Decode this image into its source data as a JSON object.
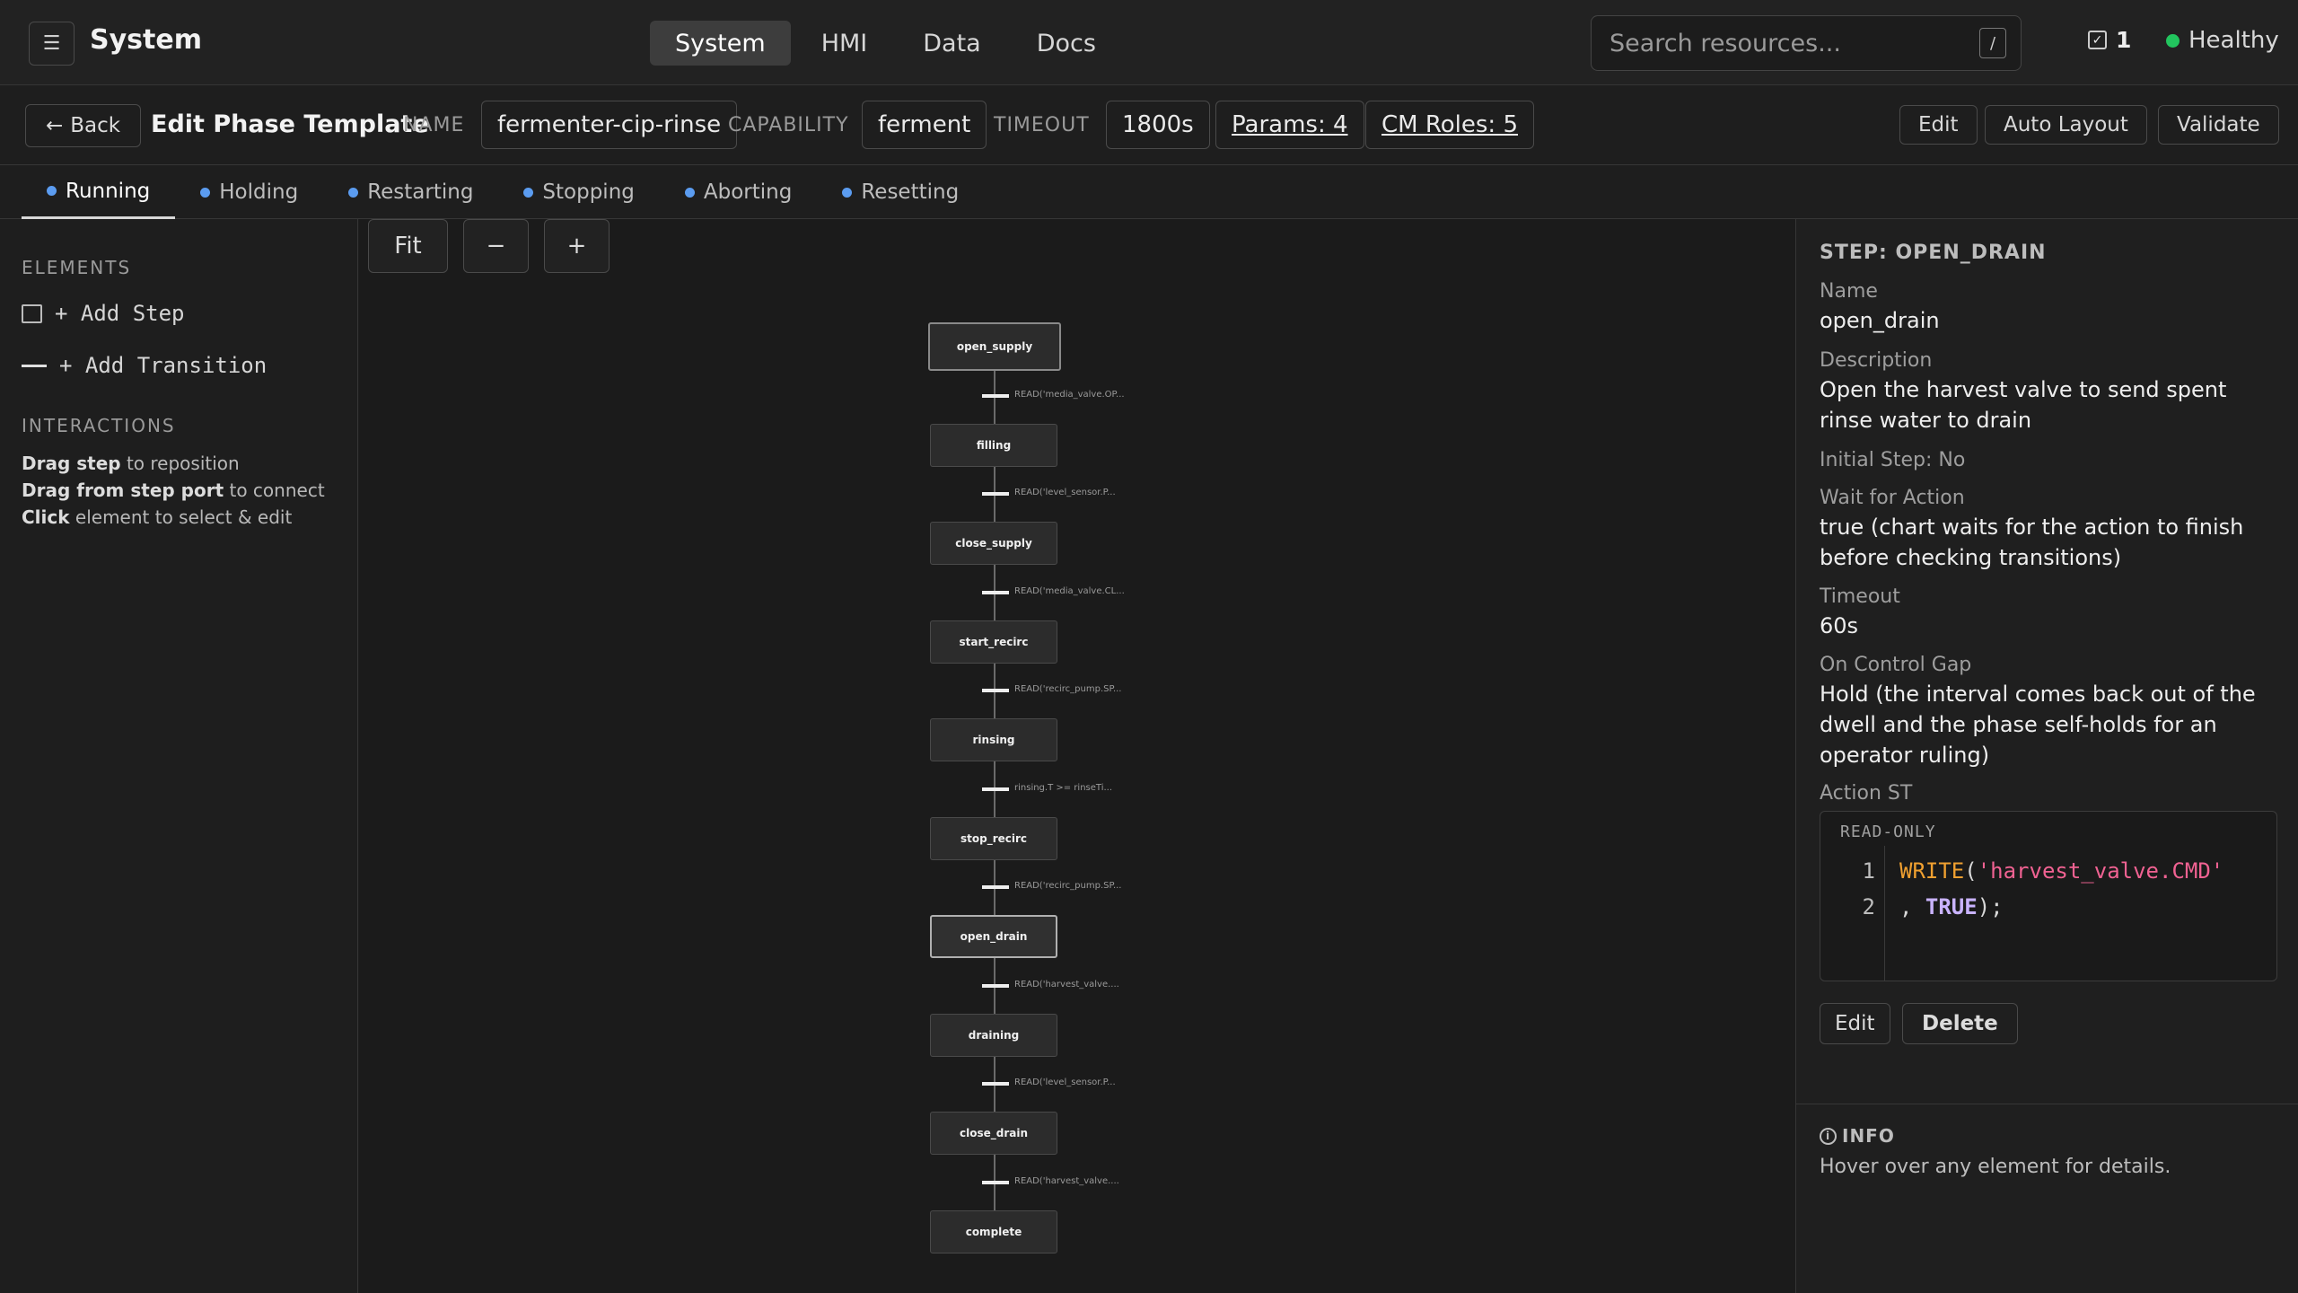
{
  "app": {
    "title": "System",
    "menu_icon": "hamburger-icon"
  },
  "nav": {
    "items": [
      "System",
      "HMI",
      "Data",
      "Docs"
    ],
    "active": "System"
  },
  "search": {
    "placeholder": "Search resources...",
    "shortcut": "/"
  },
  "status": {
    "task_count": "1",
    "health_label": "Healthy",
    "health_color": "#22c55e"
  },
  "editor": {
    "back_label": "Back",
    "title": "Edit Phase Template",
    "name_label": "NAME",
    "name_value": "fermenter-cip-rinse",
    "capability_label": "CAPABILITY",
    "capability_value": "ferment",
    "timeout_label": "TIMEOUT",
    "timeout_value": "1800s",
    "params_link": "Params: 4",
    "cm_roles_link": "CM Roles: 5",
    "buttons": {
      "edit": "Edit",
      "auto_layout": "Auto Layout",
      "validate": "Validate"
    }
  },
  "mode_tabs": {
    "items": [
      "Running",
      "Holding",
      "Restarting",
      "Stopping",
      "Aborting",
      "Resetting"
    ],
    "active": "Running",
    "bullet_color": "#5b9cf0"
  },
  "palette": {
    "elements_title": "ELEMENTS",
    "add_step": "+ Add Step",
    "add_transition": "+ Add Transition",
    "interactions_title": "INTERACTIONS",
    "hints": [
      {
        "bold": "Drag step",
        "rest": " to reposition"
      },
      {
        "bold": "Drag from step port",
        "rest": " to connect"
      },
      {
        "bold": "Click",
        "rest": " element to select & edit"
      }
    ]
  },
  "canvas": {
    "zoom": {
      "fit": "Fit",
      "out": "−",
      "in": "+"
    },
    "steps": [
      {
        "name": "open_supply",
        "initial": true
      },
      {
        "name": "filling"
      },
      {
        "name": "close_supply"
      },
      {
        "name": "start_recirc"
      },
      {
        "name": "rinsing"
      },
      {
        "name": "stop_recirc"
      },
      {
        "name": "open_drain",
        "selected": true
      },
      {
        "name": "draining"
      },
      {
        "name": "close_drain"
      },
      {
        "name": "complete"
      }
    ],
    "transitions": [
      "READ('media_valve.OP...",
      "READ('level_sensor.P...",
      "READ('media_valve.CL...",
      "READ('recirc_pump.SP...",
      "rinsing.T >= rinseTi...",
      "READ('recirc_pump.SP...",
      "READ('harvest_valve....",
      "READ('level_sensor.P...",
      "READ('harvest_valve...."
    ]
  },
  "inspector": {
    "title": "STEP: OPEN_DRAIN",
    "name_label": "Name",
    "name_value": "open_drain",
    "description_label": "Description",
    "description_value": "Open the harvest valve to send spent rinse water to drain",
    "initial_step": "Initial Step: No",
    "wait_label": "Wait for Action",
    "wait_value": "true (chart waits for the action to finish before checking transitions)",
    "timeout_label": "Timeout",
    "timeout_value": "60s",
    "gap_label": "On Control Gap",
    "gap_value": "Hold (the interval comes back out of the dwell and the phase self-holds for an operator ruling)",
    "action_label": "Action ST",
    "code_readonly": "READ-ONLY",
    "code_line_numbers": [
      "1",
      "2"
    ],
    "code": {
      "l1_fn": "WRITE",
      "l1_open": "(",
      "l1_str": "'harvest_valve.CMD'",
      "l2_comma": ", ",
      "l2_kw": "TRUE",
      "l2_close": ");"
    },
    "edit_button": "Edit",
    "delete_button": "Delete",
    "info_title": "INFO",
    "info_text": "Hover over any element for details."
  }
}
